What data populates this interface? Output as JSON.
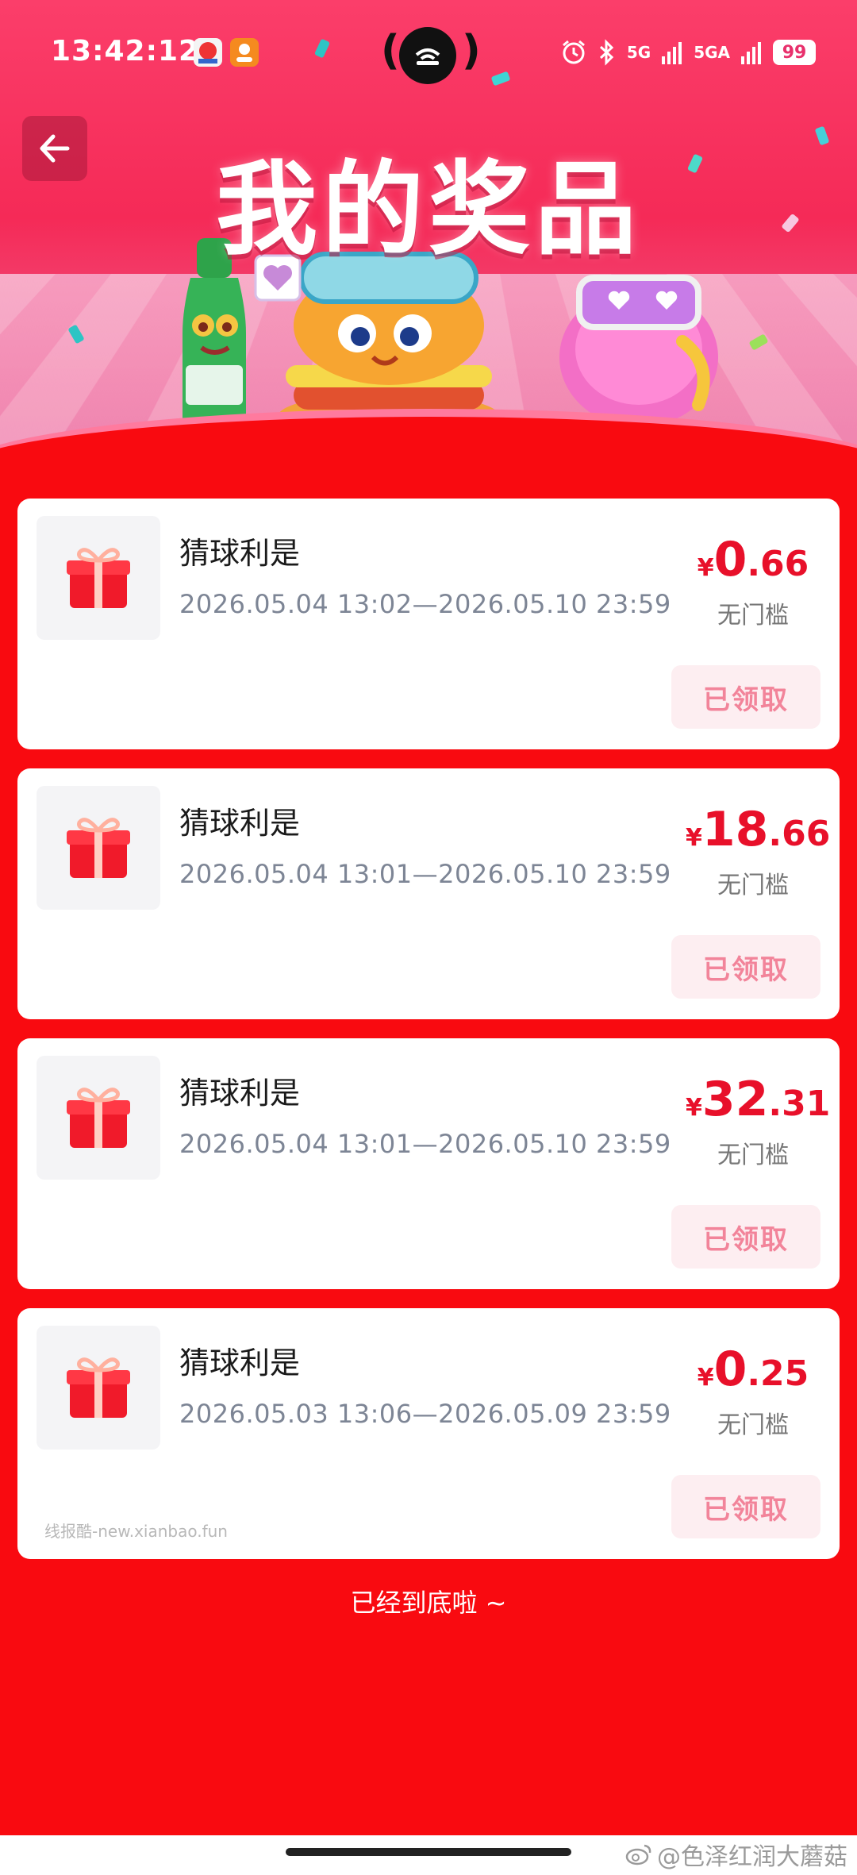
{
  "status_bar": {
    "time": "13:42:12",
    "network_1": "5G",
    "network_2": "5GA",
    "battery": "99",
    "icons": [
      "app-icon-1",
      "app-icon-2",
      "dynamic-island-icon",
      "alarm-icon",
      "bluetooth-icon",
      "signal-icon",
      "signal-icon"
    ]
  },
  "header": {
    "title": "我的奖品",
    "back_icon": "arrow-left-icon"
  },
  "prizes": [
    {
      "name": "猜球利是",
      "period": "2026.05.04 13:02—2026.05.10 23:59",
      "currency": "¥",
      "amount_int": "0",
      "amount_dec": ".66",
      "threshold": "无门槛",
      "status": "已领取"
    },
    {
      "name": "猜球利是",
      "period": "2026.05.04 13:01—2026.05.10 23:59",
      "currency": "¥",
      "amount_int": "18",
      "amount_dec": ".66",
      "threshold": "无门槛",
      "status": "已领取"
    },
    {
      "name": "猜球利是",
      "period": "2026.05.04 13:01—2026.05.10 23:59",
      "currency": "¥",
      "amount_int": "32",
      "amount_dec": ".31",
      "threshold": "无门槛",
      "status": "已领取"
    },
    {
      "name": "猜球利是",
      "period": "2026.05.03 13:06—2026.05.09 23:59",
      "currency": "¥",
      "amount_int": "0",
      "amount_dec": ".25",
      "threshold": "无门槛",
      "status": "已领取"
    }
  ],
  "watermark_small": "线报酷-new.xianbao.fun",
  "end_text": "已经到底啦 ~",
  "weibo_watermark": "@色泽红润大蘑菇",
  "colors": {
    "page_background": "#f90a10",
    "accent_red": "#e8102a",
    "claimed_bg": "#fdeef1",
    "claimed_text": "#f2849a"
  }
}
